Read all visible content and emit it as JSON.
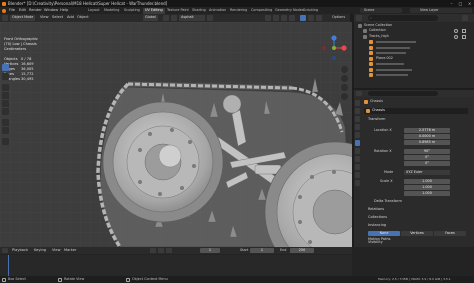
{
  "window": {
    "title": "Blender* [D:\\Creativity\\Personal\\M18 Hellcat\\Super Hellcat - WarThunder.blend]"
  },
  "menu": {
    "items": [
      "File",
      "Edit",
      "Render",
      "Window",
      "Help"
    ],
    "workspaces": [
      "Layout",
      "Modeling",
      "Sculpting",
      "UV Editing",
      "Texture Paint",
      "Shading",
      "Animation",
      "Rendering",
      "Compositing",
      "Geometry Nodes",
      "Scripting"
    ],
    "active_workspace": "UV Editing",
    "scene_label": "Scene",
    "view_layer_label": "View Layer"
  },
  "viewport_header": {
    "mode": "Object Mode",
    "view": "View",
    "select": "Select",
    "add": "Add",
    "object": "Object",
    "orientation": "Global",
    "snap_target": "Asphalt",
    "options": "Options"
  },
  "overlay": {
    "view_name": "Front Orthographic",
    "collection": "(70) Low | Chassis",
    "units": "Centimeters",
    "stats": [
      {
        "label": "Objects",
        "value": "0 / 78"
      },
      {
        "label": "Vertices",
        "value": "16,609"
      },
      {
        "label": "Edges",
        "value": "36,005"
      },
      {
        "label": "Faces",
        "value": "15,772"
      },
      {
        "label": "Triangles",
        "value": "30,495"
      }
    ]
  },
  "outliner": {
    "search_placeholder": "",
    "items": [
      {
        "label": "Scene Collection",
        "depth": 0
      },
      {
        "label": "Collection",
        "depth": 1
      },
      {
        "label": "Tracks_high",
        "depth": 1
      },
      {
        "label": "",
        "depth": 2
      },
      {
        "label": "",
        "depth": 2
      },
      {
        "label": "",
        "depth": 2
      },
      {
        "label": "Plane.002",
        "depth": 2
      },
      {
        "label": "",
        "depth": 2
      },
      {
        "label": "",
        "depth": 2
      },
      {
        "label": "",
        "depth": 2
      }
    ]
  },
  "properties": {
    "object_name_field": "Chassis",
    "object_name": "Chassis",
    "transform_label": "Transform",
    "location_label": "Location X",
    "location": [
      "2.5776 m",
      "0.0000 m",
      "0.8985 m"
    ],
    "rotation_label": "Rotation X",
    "rotation": [
      "90°",
      "0°",
      "0°"
    ],
    "mode_label": "Mode",
    "mode_value": "XYZ Euler",
    "scale_label": "Scale X",
    "scale": [
      "1.000",
      "1.000",
      "1.000"
    ],
    "sections": [
      "Delta Transform",
      "Relations",
      "Collections",
      "Instancing"
    ],
    "instancing_buttons": [
      "None",
      "Vertices",
      "Faces"
    ],
    "sections_after": [
      "Motion Paths",
      "Visibility",
      "Motion Blur"
    ]
  },
  "timeline": {
    "playback": "Playback",
    "keying": "Keying",
    "view": "View",
    "marker": "Marker",
    "start_label": "Start",
    "start": "1",
    "end_label": "End",
    "end": "250",
    "current_frame": "1"
  },
  "statusbar": {
    "left": "Box Select",
    "middle": "Rotate View",
    "right": "Object Context Menu",
    "version": "Memory: 2.5 / 3 MiB | VRAM: 3.9 / 8.0 GiB | 3.5.1"
  },
  "colors": {
    "accent": "#4772b3",
    "viewport_bg": "#3d3d3d",
    "panel_bg": "#2b2b2b",
    "x_axis": "#e8474e",
    "y_axis": "#7fb13a",
    "z_axis": "#3f7fd7"
  }
}
